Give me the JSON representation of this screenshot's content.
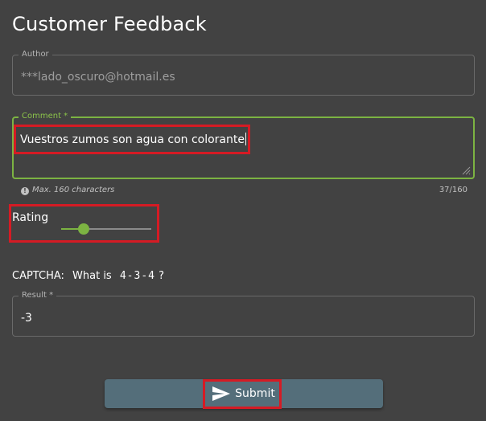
{
  "page_title": "Customer Feedback",
  "author": {
    "label": "Author",
    "value": "***lado_oscuro@hotmail.es"
  },
  "comment": {
    "label": "Comment *",
    "value": "Vuestros zumos son agua con colorante",
    "hint": "Max. 160 characters",
    "counter": "37/160"
  },
  "rating": {
    "label": "Rating",
    "value_fraction": 0.25
  },
  "captcha": {
    "label": "CAPTCHA:",
    "question": "What is",
    "expression": "4-3-4",
    "suffix": "?"
  },
  "result": {
    "label": "Result *",
    "value": "-3"
  },
  "submit": {
    "label": "Submit"
  },
  "colors": {
    "background": "#424242",
    "accent": "#7cb342",
    "button": "#546e7a",
    "highlight": "#d51b24"
  },
  "icons": {
    "hint": "info-circle-icon",
    "submit": "send-icon",
    "resize": "resize-handle-icon"
  }
}
